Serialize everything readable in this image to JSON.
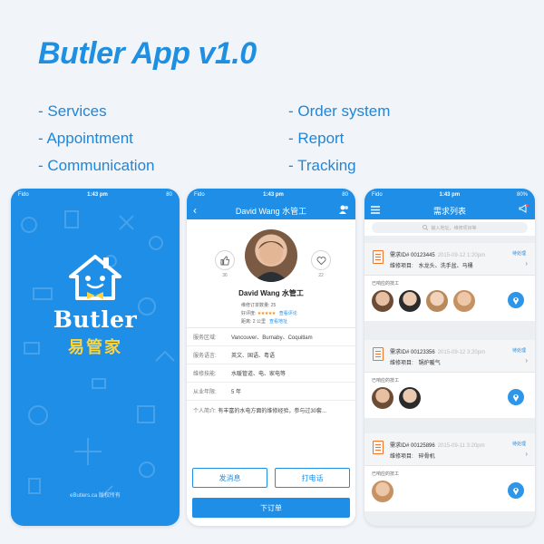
{
  "title": "Butler App v1.0",
  "features_left": [
    "- Services",
    "- Appointment",
    "- Communication"
  ],
  "features_right": [
    "- Order system",
    "- Report",
    "- Tracking"
  ],
  "colors": {
    "primary": "#1e8ee6",
    "accent_yellow": "#ffd43b",
    "accent_orange": "#f0762b"
  },
  "phone1": {
    "status": {
      "carrier": "Fido",
      "time": "1:43 pm",
      "battery": "80"
    },
    "brand": "Butler",
    "brand_cn": "易管家",
    "footer": "eButlers.ca 版权所有"
  },
  "phone2": {
    "status": {
      "carrier": "Fido",
      "time": "1:43 pm",
      "battery": "80"
    },
    "nav_title": "David Wang 水管工",
    "like_count": "36",
    "fav_count": "22",
    "name": "David Wang 水管工",
    "stat_orders_label": "维修订单数量:",
    "stat_orders_value": "25",
    "stat_rating_label": "好评度:",
    "stat_rating_stars": "★★★★★",
    "stat_rating_link": "查看评论",
    "stat_distance_label": "距离:",
    "stat_distance_value": "2 公里",
    "stat_distance_link": "查看地址",
    "rows": [
      {
        "k": "服务区域:",
        "v": "Vancouver、Burnaby、Coquitlam"
      },
      {
        "k": "服务语言:",
        "v": "英文、国语、粤语"
      },
      {
        "k": "维修技能:",
        "v": "水暖管道、电、家电等"
      },
      {
        "k": "从业年限:",
        "v": "5 年"
      }
    ],
    "bio_label": "个人简介:",
    "bio_text": "有丰富的水电方面的维修经验，参与过30套...",
    "btn_message": "发消息",
    "btn_call": "打电话",
    "btn_order": "下订单"
  },
  "phone3": {
    "status": {
      "carrier": "Fido",
      "time": "1:43 pm",
      "battery": "80%"
    },
    "nav_title": "需求列表",
    "search_placeholder": "输入地址，维修项目等",
    "cards": [
      {
        "id": "需求ID# 00123445",
        "date": "2015-09-12 1:20pm",
        "badge": "待处理",
        "item_label": "维修项目:",
        "item_value": "水龙头、洗手盆、马桶",
        "responders_label": "已响应的技工",
        "faces": 4
      },
      {
        "id": "需求ID# 00123356",
        "date": "2015-09-12 3:20pm",
        "badge": "待处理",
        "item_label": "维修项目:",
        "item_value": "锅炉暖气",
        "responders_label": "已响应的技工",
        "faces": 2
      },
      {
        "id": "需求ID# 00125896",
        "date": "2015-09-11 3:20pm",
        "badge": "待处理",
        "item_label": "维修项目:",
        "item_value": "碎骨机",
        "responders_label": "已响应的技工",
        "faces": 1
      }
    ]
  }
}
